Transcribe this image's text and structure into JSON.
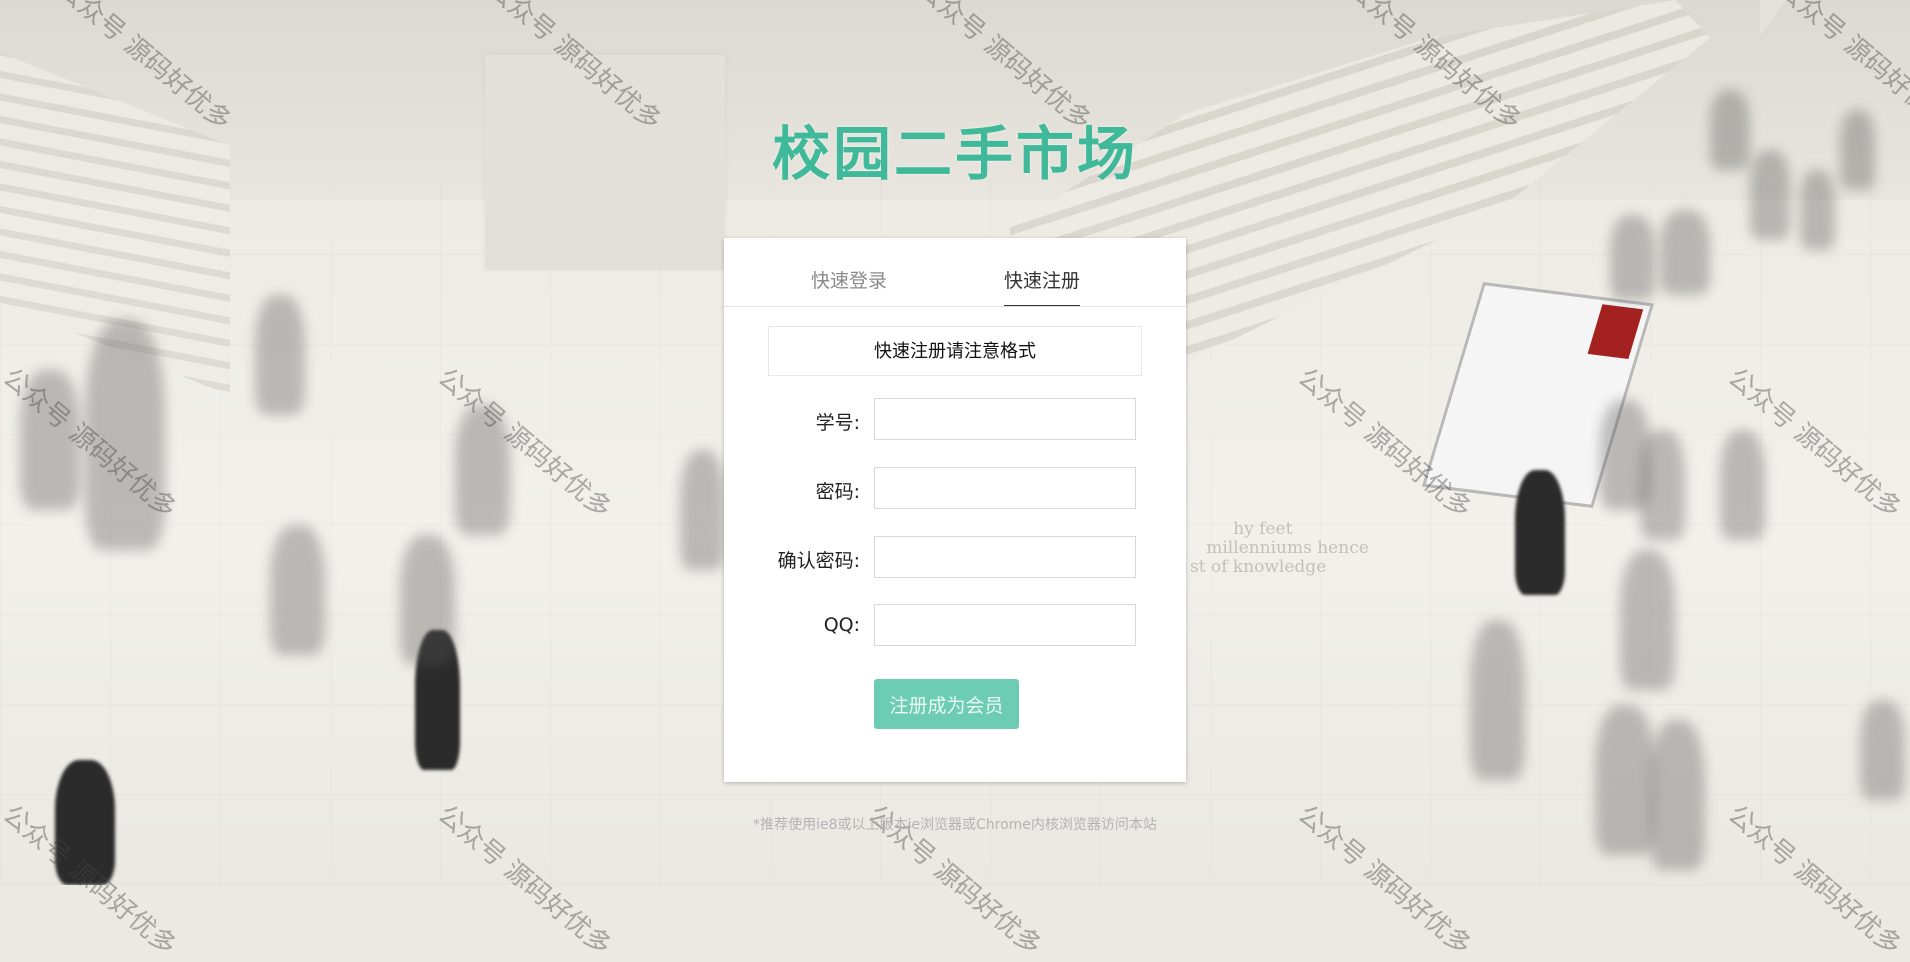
{
  "site_title": "校园二手市场",
  "tabs": {
    "login": "快速登录",
    "register": "快速注册",
    "active": "register"
  },
  "notice": "快速注册请注意格式",
  "form": {
    "student_id_label": "学号:",
    "password_label": "密码:",
    "confirm_password_label": "确认密码:",
    "qq_label": "QQ:",
    "student_id_value": "",
    "password_value": "",
    "confirm_password_value": "",
    "qq_value": ""
  },
  "submit_label": "注册成为会员",
  "footer_note": "*推荐使用ie8或以上版本ie浏览器或Chrome内核浏览器访问本站",
  "watermark_text": "公众号 源码好优多",
  "colors": {
    "brand": "#3fb99a",
    "button": "#6ccdb4"
  }
}
